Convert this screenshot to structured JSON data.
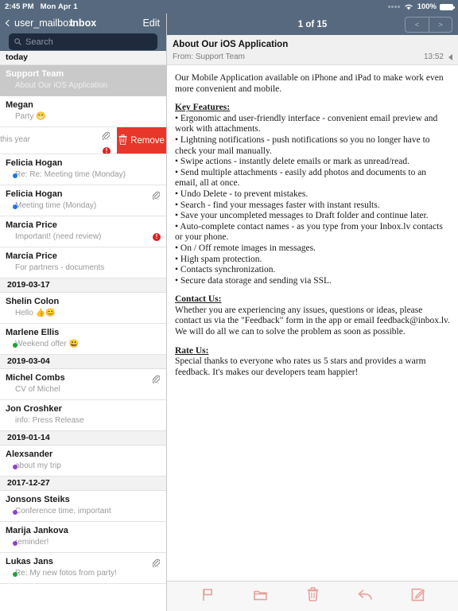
{
  "statusbar": {
    "time": "2:45 PM",
    "date": "Mon Apr 1",
    "battery_percent": "100%",
    "wifi_icon": "wifi-icon",
    "battery_icon": "battery-icon"
  },
  "mailbox_header": {
    "back_label": "user_mailbox",
    "title": "Inbox",
    "edit_label": "Edit",
    "back_icon": "chevron-left-icon"
  },
  "search": {
    "placeholder": "Search",
    "value": "",
    "icon": "search-icon"
  },
  "swipe_action": {
    "remove_label": "Remove",
    "icon": "trash-icon",
    "color": "#e8362a"
  },
  "message_list": [
    {
      "type": "date",
      "label": "today"
    },
    {
      "type": "message",
      "sender": "Support Team",
      "preview": "About Our iOS Application",
      "selected": true,
      "dot": "",
      "attachment": false,
      "flagged": false,
      "emoji": ""
    },
    {
      "type": "message",
      "sender": "Megan",
      "preview": "Party",
      "selected": false,
      "dot": "",
      "attachment": false,
      "flagged": false,
      "emoji": "😁"
    },
    {
      "type": "message_swiped",
      "sender": "",
      "preview": "ents for this year",
      "selected": false,
      "dot": "",
      "attachment": true,
      "flagged": true,
      "emoji": ""
    },
    {
      "type": "message",
      "sender": "Felicia Hogan",
      "preview": "Re: Re: Meeting time (Monday)",
      "selected": false,
      "dot": "#1c77e8",
      "attachment": false,
      "flagged": false,
      "emoji": ""
    },
    {
      "type": "message",
      "sender": "Felicia Hogan",
      "preview": "Meeting time (Monday)",
      "selected": false,
      "dot": "#1c77e8",
      "attachment": true,
      "flagged": false,
      "emoji": ""
    },
    {
      "type": "message",
      "sender": "Marcia Price",
      "preview": "Important! (need review)",
      "selected": false,
      "dot": "",
      "attachment": false,
      "flagged": true,
      "emoji": ""
    },
    {
      "type": "message",
      "sender": "Marcia Price",
      "preview": "For partners - documents",
      "selected": false,
      "dot": "",
      "attachment": false,
      "flagged": false,
      "emoji": ""
    },
    {
      "type": "date",
      "label": "2019-03-17"
    },
    {
      "type": "message",
      "sender": "Shelin Colon",
      "preview": "Hello",
      "selected": false,
      "dot": "",
      "attachment": false,
      "flagged": false,
      "emoji": "👍😊"
    },
    {
      "type": "message",
      "sender": "Marlene    Ellis",
      "preview": "Weekend offer",
      "selected": false,
      "dot": "#1aa23a",
      "attachment": false,
      "flagged": false,
      "emoji": "😃"
    },
    {
      "type": "date",
      "label": "2019-03-04"
    },
    {
      "type": "message",
      "sender": "Michel Combs",
      "preview": "CV of Michel",
      "selected": false,
      "dot": "",
      "attachment": true,
      "flagged": false,
      "emoji": ""
    },
    {
      "type": "message",
      "sender": "Jon Croshker",
      "preview": "info: Press Release",
      "selected": false,
      "dot": "",
      "attachment": false,
      "flagged": false,
      "emoji": ""
    },
    {
      "type": "date",
      "label": "2019-01-14"
    },
    {
      "type": "message",
      "sender": "Alexsander",
      "preview": "about my trip",
      "selected": false,
      "dot": "#8e44c8",
      "attachment": false,
      "flagged": false,
      "emoji": ""
    },
    {
      "type": "date",
      "label": "2017-12-27"
    },
    {
      "type": "message",
      "sender": "Jonsons Steiks",
      "preview": "Conference time, important",
      "selected": false,
      "dot": "#8e44c8",
      "attachment": false,
      "flagged": false,
      "emoji": ""
    },
    {
      "type": "message",
      "sender": "Marija Jankova",
      "preview": "reminder!",
      "selected": false,
      "dot": "#8e44c8",
      "attachment": false,
      "flagged": false,
      "emoji": ""
    },
    {
      "type": "message",
      "sender": "Lukas Jans",
      "preview": "Re: My new fotos from party!",
      "selected": false,
      "dot": "#1aa23a",
      "attachment": true,
      "flagged": false,
      "emoji": ""
    }
  ],
  "reader_header": {
    "counter": "1 of 15",
    "prev_label": "<",
    "next_label": ">"
  },
  "mail": {
    "subject": "About Our iOS Application",
    "from": "From: Support Team",
    "time": "13:52",
    "collapse_icon": "triangle-left-icon",
    "intro": "Our Mobile Application available on iPhone and iPad to make work even more convenient and mobile.",
    "features_title": "Key Features:",
    "features": [
      "• Ergonomic and user-friendly interface - convenient email preview and work with attachments.",
      "• Lightning notifications - push notifications so you no longer have to check your mail manually.",
      "• Swipe actions - instantly delete emails or mark as unread/read.",
      "• Send multiple attachments - easily add photos and documents to an email, all at once.",
      "• Undo Delete - to prevent mistakes.",
      "• Search - find your messages faster with instant results.",
      "• Save your uncompleted messages to Draft folder and continue later.",
      "• Auto-complete contact names - as you type from your Inbox.lv contacts or your phone.",
      "• On / Off remote images in messages.",
      "• High spam protection.",
      "• Contacts synchronization.",
      "• Secure data storage and sending via SSL."
    ],
    "contact_title": "Contact Us:",
    "contact_body": "Whether you are experiencing any issues, questions or ideas, please contact us via the \"Feedback\" form in the app or email feedback@inbox.lv. We will do all we can to solve the problem as soon as possible.",
    "rate_title": "Rate Us:",
    "rate_body": "Special thanks to everyone who rates us 5 stars and provides a warm feedback. It's makes our developers team happier!"
  },
  "toolbar": {
    "accent_color": "#e8a09a",
    "buttons": [
      {
        "name": "flag-icon",
        "label": "Flag"
      },
      {
        "name": "folder-icon",
        "label": "Move to folder"
      },
      {
        "name": "trash-icon",
        "label": "Delete"
      },
      {
        "name": "reply-icon",
        "label": "Reply"
      },
      {
        "name": "compose-icon",
        "label": "Compose"
      }
    ]
  },
  "colors": {
    "header_bg": "#56697e",
    "search_bg": "#1f2b3c",
    "selected_row": "#c9c9c9",
    "remove_red": "#e8362a",
    "toolbar_pink": "#e8a09a"
  }
}
